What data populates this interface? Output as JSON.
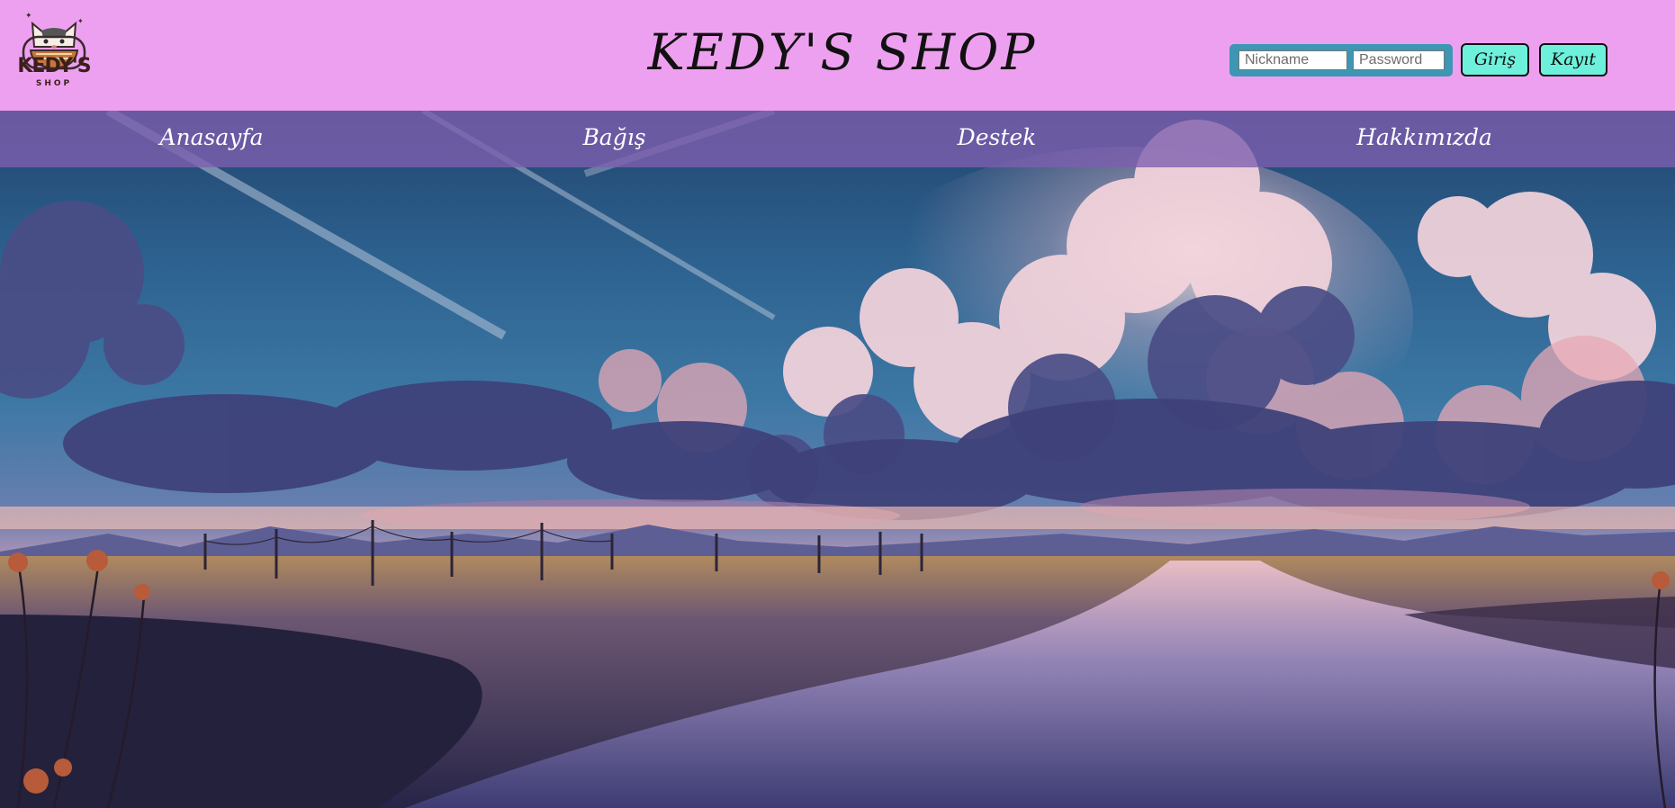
{
  "header": {
    "title": "KEDY'S SHOP",
    "logo": {
      "brand": "KEDY'S",
      "sub": "SHOP",
      "icon": "cat-icon"
    },
    "login": {
      "nickname_placeholder": "Nickname",
      "password_placeholder": "Password",
      "login_label": "Giriş",
      "register_label": "Kayıt"
    }
  },
  "nav": {
    "items": [
      {
        "label": "Anasayfa"
      },
      {
        "label": "Bağış"
      },
      {
        "label": "Destek"
      },
      {
        "label": "Hakkımızda"
      }
    ]
  },
  "hero": {
    "image": "sunset-cloudy-sky-landscape"
  },
  "colors": {
    "header_bg": "#eea0f0",
    "nav_bg": "#7d5faf",
    "login_box": "#3c96b4",
    "button_bg": "#6ef1dc"
  }
}
